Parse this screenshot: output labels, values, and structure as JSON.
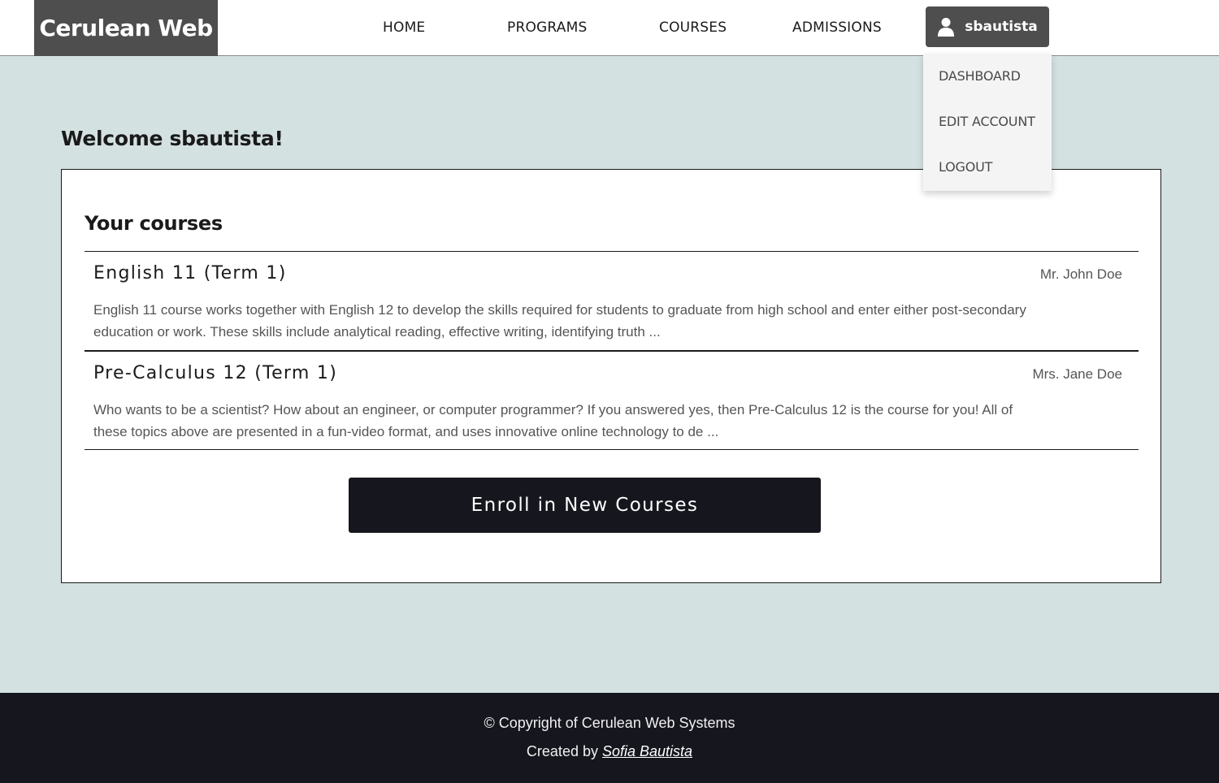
{
  "brand": {
    "name": "Cerulean Web"
  },
  "nav": {
    "items": [
      {
        "label": "HOME"
      },
      {
        "label": "PROGRAMS"
      },
      {
        "label": "COURSES"
      },
      {
        "label": "ADMISSIONS"
      }
    ],
    "user": {
      "username": "sbautista",
      "icon": "user-icon"
    }
  },
  "dropdown": {
    "items": [
      {
        "label": "DASHBOARD"
      },
      {
        "label": "EDIT ACCOUNT"
      },
      {
        "label": "LOGOUT"
      }
    ]
  },
  "main": {
    "welcome": "Welcome sbautista!",
    "section_title": "Your courses",
    "courses": [
      {
        "name": "English 11 (Term 1)",
        "teacher": "Mr. John Doe",
        "description": "English 11 course works together with English 12 to develop the skills required for students to graduate from high school and enter either post-secondary education or work. These skills include analytical reading, effective writing, identifying truth ..."
      },
      {
        "name": "Pre-Calculus 12 (Term 1)",
        "teacher": "Mrs. Jane Doe",
        "description": "Who wants to be a scientist? How about an engineer, or computer programmer? If you answered yes, then Pre-Calculus 12 is the course for you! All of these topics above are presented in a fun-video format, and uses innovative online technology to de ..."
      }
    ],
    "enroll_label": "Enroll in New Courses"
  },
  "footer": {
    "copyright": "© Copyright of Cerulean Web Systems",
    "created_by_prefix": "Created by ",
    "author": "Sofia Bautista"
  },
  "colors": {
    "page_background": "#d4e1e1",
    "brand_background": "#4e4e4e",
    "dark_accent": "#16161f",
    "card_background": "#ffffff"
  }
}
